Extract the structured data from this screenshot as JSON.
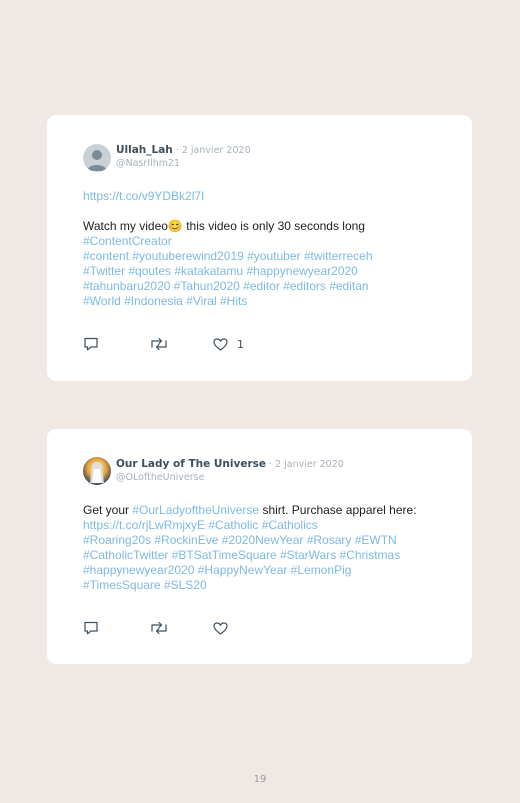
{
  "tweets": [
    {
      "author": "Ullah_Lah",
      "date": " · 2 janvier 2020",
      "handle": "@NasrIlhm21",
      "url": "https://t.co/v9YDBk2l7I",
      "text_plain": "Watch my video",
      "emoji": "😊",
      "text_rest": " this video is only 30 seconds long",
      "hashtags": "#ContentCreator\n#content #youtuberewind2019 #youtuber #twitterreceh\n#Twitter #qoutes #katakatamu #happynewyear2020\n#tahunbaru2020 #Tahun2020 #editor #editors #editan\n#World #Indonesia #Viral #Hits",
      "likes": "1",
      "avatar_icon": "default-user-avatar"
    },
    {
      "author": "Our Lady of The Universe",
      "date": " · 2 janvier 2020",
      "handle": "@OLoftheUniverse",
      "text_before": "Get your ",
      "hashtag_inline": "#OurLadyoftheUniverse",
      "text_after": " shirt. Purchase apparel here: ",
      "url": "https://t.co/rjLwRmjxyE",
      "hashtags": " #Catholic #Catholics\n#Roaring20s #RockinEve #2020NewYear #Rosary #EWTN\n#CatholicTwitter #BTSatTimeSquare #StarWars #Christmas\n#happynewyear2020 #HappyNewYear #LemonPig\n#TimesSquare #SLS20",
      "likes": "",
      "avatar_icon": "virgin-mary-avatar"
    }
  ],
  "page_number": "19",
  "colors": {
    "background": "#efe8e4",
    "link": "#7fb9e2",
    "name": "#3d4f5e",
    "muted": "#a8b2bb"
  },
  "icons": [
    "reply-icon",
    "retweet-icon",
    "heart-icon"
  ]
}
